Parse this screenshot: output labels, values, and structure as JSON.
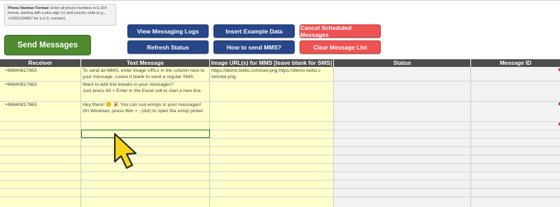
{
  "note": {
    "heading": "Phone Number Format:",
    "text": "Enter all phone numbers in E.164 format, starting with a plus sign (+) and country code (e.g., +15551234567 for a U.S. number)."
  },
  "buttons": {
    "send_messages": "Send Messages",
    "view_logs": "View Messaging Logs",
    "insert_example": "Insert Example Data",
    "cancel_scheduled": "Cancel Scheduled Messages",
    "refresh_status": "Refresh Status",
    "how_to_mms": "How to send MMS?",
    "clear_list": "Clear Message List"
  },
  "table": {
    "headers": [
      "Receiver",
      "Text Message",
      "Image URL(s) for MMS [leave blank for SMS]",
      "Status",
      "Message ID"
    ],
    "rows": [
      {
        "receiver": "+66640817863",
        "message": [
          "To send an MMS, enter image URLs in the column next to",
          "your message. Leave it blank to send a regular SMS."
        ],
        "image_url": [
          "https://demo.twilio.com/owl.png;https://demo.twilio.c",
          "om/owl.png"
        ]
      },
      {
        "receiver": "+66640817863",
        "message": [
          "Want to add line breaks in your messages?",
          "Just press Alt + Enter in the Excel cell to start a new line."
        ],
        "image_url": []
      },
      {
        "receiver": "+66640817863",
        "message": [
          "Hey there! 😊 🎉 You can use emojis in your messages!",
          "On Windows, press Win + . (dot) to open the emoji picker."
        ],
        "image_url": []
      }
    ]
  },
  "colors": {
    "header_bg": "#4d4d4d",
    "yellow_cells": "#ffffcc",
    "gray_cells": "#f2f2f2",
    "blue_button": "#27478a",
    "red_button": "#f05353",
    "green_button": "#4e8a2e"
  }
}
